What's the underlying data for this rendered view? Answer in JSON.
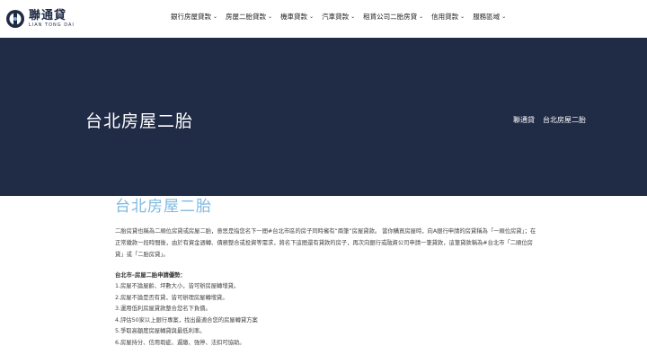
{
  "brand": {
    "name": "聯通貸",
    "sub": "LIAN TONG DAI",
    "color": "#1f2a44"
  },
  "nav": [
    {
      "label": "銀行房屋貸款"
    },
    {
      "label": "房屋二胎貸款"
    },
    {
      "label": "機車貸款"
    },
    {
      "label": "汽車貸款"
    },
    {
      "label": "租賃公司二胎房貸"
    },
    {
      "label": "信用貸款"
    },
    {
      "label": "服務區域"
    }
  ],
  "banner": {
    "title": "台北房屋二胎",
    "breadcrumb_home": "聯通貸",
    "breadcrumb_current": "台北房屋二胎",
    "bg_color": "#202b45"
  },
  "content": {
    "title": "台北房屋二胎",
    "paragraph": "二胎房貸也稱為二順位房貸或房屋二胎，意思是指您名下一間#台北市區的房子同時擁有“兩筆”房屋貸款。 當你購買房屋時，向A銀行申請的房貸稱為「一順位房貸」；在正常繳款一段時間後，由於有資金週轉、債務整合或投資等需求，將名下這間還有貸款的房子，再次向銀行或融資公司申請一筆貸款，這筆貸款稱為#台北市「二順位房貸」或「二胎房貸」。",
    "list_title": "台北市–房屋二胎申請優勢：",
    "list": [
      "1.房屋不論屋齡、坪數大小，皆可辦房屋轉增貸。",
      "2.房屋不論是否有貸，皆可辦理房屋轉增貸。",
      "3.運用低利房屋貸款整合您名下負債。",
      "4.評估50家以上銀行專案，找出最適合您的房屋轉貸方案",
      "5.爭取高額度房屋轉貸與最低利率。",
      "6.房屋持分、信用瑕疵、遲繳、強停、法扣可協助。"
    ],
    "title_color": "#7fb9e0"
  },
  "icons": {
    "logo": "logo-mark-icon",
    "dropdown": "chevron-down-icon"
  }
}
